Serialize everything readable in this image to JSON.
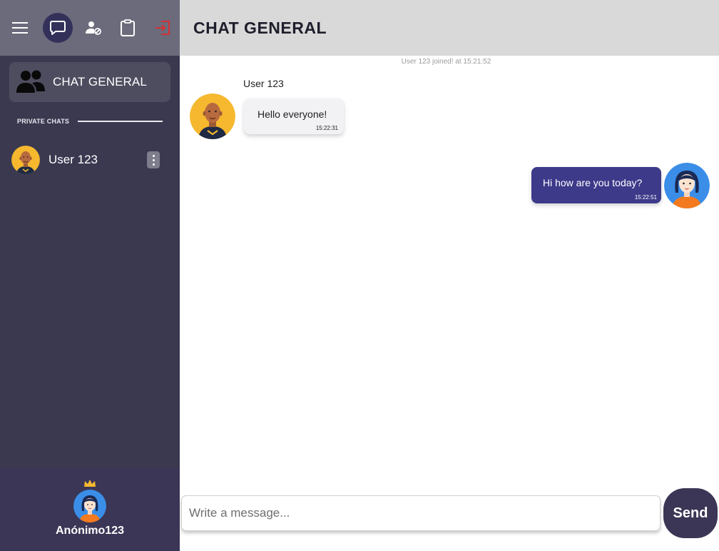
{
  "colors": {
    "sidebar_bg": "#3a3950",
    "sidebar_top_bg": "#6b6b7c",
    "accent": "#3d3a8a",
    "footer_bg": "#3b3656",
    "header_bg": "#d9d9d9",
    "logout_icon": "#e22b2b"
  },
  "toolbar": {
    "icons": [
      "menu-icon",
      "chat-icon",
      "user-block-icon",
      "clipboard-icon",
      "logout-icon"
    ],
    "active": "chat-icon"
  },
  "sidebar": {
    "general_chat_label": "CHAT GENERAL",
    "private_chats_label": "PRIVATE CHATS",
    "private_chats": [
      {
        "name": "User 123"
      }
    ]
  },
  "profile": {
    "name": "Anónimo123"
  },
  "chat": {
    "title": "CHAT GENERAL",
    "system_message": "User 123 joined! at 15:21:52",
    "messages": [
      {
        "sender": "User 123",
        "text": "Hello everyone!",
        "time": "15:22:31"
      },
      {
        "sender": "",
        "text": "Hi how are you today?",
        "time": "15:22:51"
      }
    ]
  },
  "composer": {
    "placeholder": "Write a message...",
    "send_label": "Send"
  }
}
